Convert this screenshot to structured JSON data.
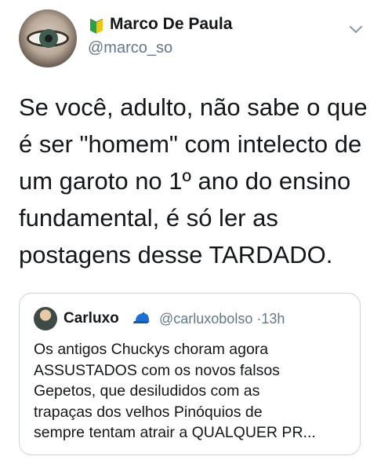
{
  "tweet": {
    "author_name": "Marco De Paula",
    "author_handle": "@marco_so",
    "badge_icon": "beginner-symbol-icon",
    "menu_icon": "chevron-down-icon",
    "text": "Se você, adulto, não sabe o que é ser \"homem\" com intelecto de um garoto no 1º ano do ensino fundamental, é só ler as postagens desse TARDADO."
  },
  "quoted_tweet": {
    "author_name": "Carluxo",
    "badge_icon": "blue-cap-icon",
    "author_handle": "@carluxobolso",
    "separator": "·",
    "time": "13h",
    "text": "Os antigos Chuckys choram agora\nASSUSTADOS com os novos falsos\nGepetos, que desiludidos com as\ntrapaças dos velhos Pinóquios de\nsempre tentam atrair a QUALQUER PR..."
  },
  "colors": {
    "text": "#14171a",
    "secondary": "#657786",
    "border": "#ccd6dd",
    "badge_green": "#2f9e44",
    "badge_yellow": "#f2c511",
    "cap_blue": "#1d6fd1"
  }
}
